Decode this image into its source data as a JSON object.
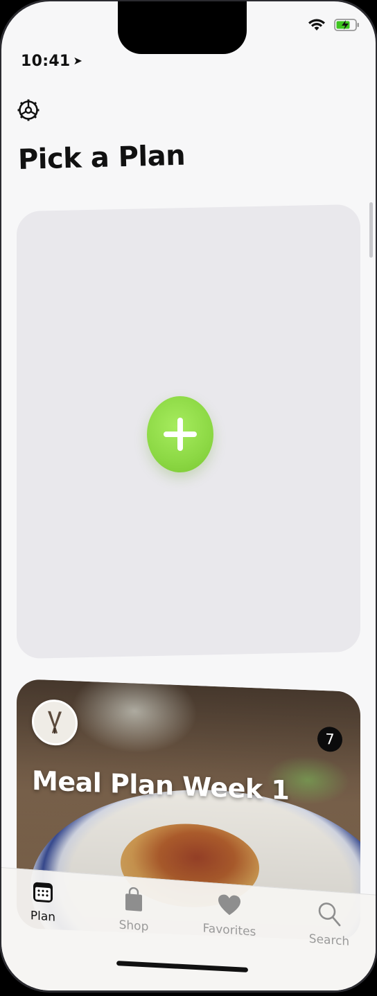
{
  "status_bar": {
    "time": "10:41",
    "location_icon": "location-arrow-icon",
    "wifi_icon": "wifi-icon",
    "battery_icon": "battery-charging-icon",
    "battery_color": "#3ec41f"
  },
  "header": {
    "settings_icon": "gear-icon",
    "title": "Pick a Plan"
  },
  "add_card": {
    "button_icon": "plus-icon",
    "accent_color": "#8cd844"
  },
  "plans": [
    {
      "name": "Meal Plan Week 1",
      "count": "7",
      "avatar_icon": "crossed-knives-icon"
    }
  ],
  "tab_bar": {
    "tabs": [
      {
        "label": "Plan",
        "icon": "calendar-icon",
        "active": true
      },
      {
        "label": "Shop",
        "icon": "shopping-bag-icon",
        "active": false
      },
      {
        "label": "Favorites",
        "icon": "heart-icon",
        "active": false
      },
      {
        "label": "Search",
        "icon": "magnifier-icon",
        "active": false
      }
    ]
  }
}
